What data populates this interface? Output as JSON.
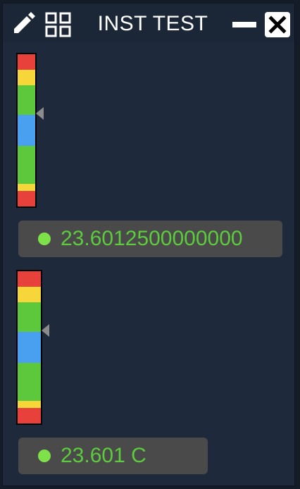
{
  "window": {
    "title": "INST TEST"
  },
  "gauges": [
    {
      "value_text": "23.6012500000000",
      "status_color": "#7ee14a"
    },
    {
      "value_text": "23.601 C",
      "status_color": "#7ee14a"
    }
  ],
  "colors": {
    "red": "#e8413c",
    "yellow": "#f7d63a",
    "green": "#5ec83d",
    "blue": "#4aa0f0",
    "value_text": "#5ccb3c",
    "panel": "#1e2a3b",
    "value_box": "#4a4a4a"
  }
}
